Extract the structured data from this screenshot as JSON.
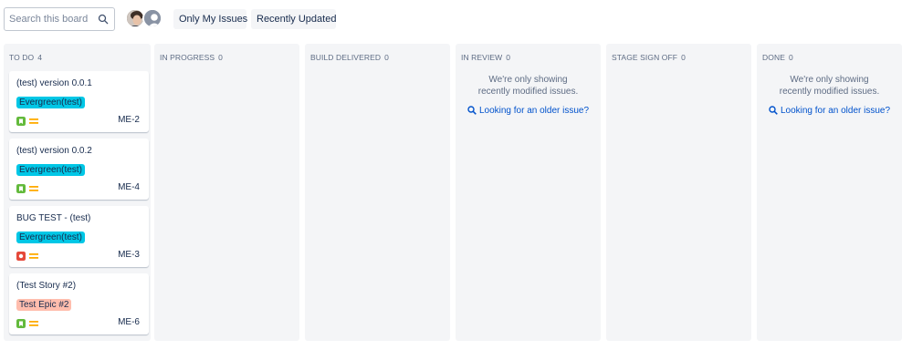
{
  "search": {
    "placeholder": "Search this board",
    "value": "",
    "icon": "search-icon"
  },
  "avatars": [
    {
      "name": "user-avatar-photo"
    },
    {
      "name": "unassigned-avatar"
    }
  ],
  "filters": {
    "only_my_issues": "Only My Issues",
    "recently_updated": "Recently Updated"
  },
  "columns": [
    {
      "title": "TO DO",
      "count": "4"
    },
    {
      "title": "IN PROGRESS",
      "count": "0"
    },
    {
      "title": "BUILD DELIVERED",
      "count": "0"
    },
    {
      "title": "IN REVIEW",
      "count": "0",
      "empty_message": "We're only showing recently modified issues.",
      "link": "Looking for an older issue?"
    },
    {
      "title": "STAGE SIGN OFF",
      "count": "0"
    },
    {
      "title": "DONE",
      "count": "0",
      "empty_message": "We're only showing recently modified issues.",
      "link": "Looking for an older issue?"
    }
  ],
  "cards": [
    {
      "title": "(test) version 0.0.1",
      "epic": "Evergreen(test)",
      "epic_color": "#00c7e6",
      "type": "story",
      "type_color": "#63ba3c",
      "priority": "medium",
      "key": "ME-2"
    },
    {
      "title": "(test) version 0.0.2",
      "epic": "Evergreen(test)",
      "epic_color": "#00c7e6",
      "type": "story",
      "type_color": "#63ba3c",
      "priority": "medium",
      "key": "ME-4"
    },
    {
      "title": "BUG TEST - (test)",
      "epic": "Evergreen(test)",
      "epic_color": "#00c7e6",
      "type": "bug",
      "type_color": "#e5493a",
      "priority": "medium",
      "key": "ME-3"
    },
    {
      "title": "(Test Story #2)",
      "epic": "Test Epic #2",
      "epic_color": "#ffbdad",
      "type": "story",
      "type_color": "#63ba3c",
      "priority": "medium",
      "key": "ME-6"
    }
  ],
  "colors": {
    "priority_medium": "#ffab00",
    "column_bg": "#f4f5f7",
    "link": "#0052cc"
  }
}
